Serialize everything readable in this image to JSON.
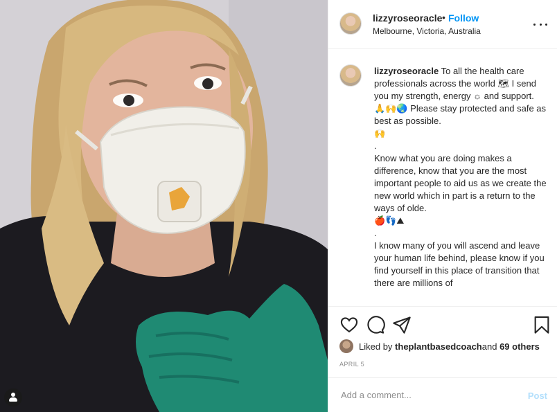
{
  "post": {
    "username": "lizzyroseoracle",
    "dot": "•",
    "follow_label": "Follow",
    "location": "Melbourne, Victoria, Australia",
    "more_icon": "more-horizontal-icon"
  },
  "caption": {
    "username": "lizzyroseoracle",
    "lines": [
      " To all the health care professionals across the world 🗺 I send you my strength, energy ☼ and support.",
      "🙏🙌🌏 Please stay protected and safe as best as possible.",
      "🙌",
      ".",
      "Know what you are doing makes a difference, know that you are the most important people to aid us as we create the new world which in part is a return to the ways of olde.",
      "🍎👣⛰",
      ".",
      "I know many of you will ascend and leave your human life behind, please know if you find yourself in this place of transition that there are millions of"
    ]
  },
  "actions": {
    "like_icon": "heart-icon",
    "comment_icon": "comment-icon",
    "share_icon": "paper-plane-icon",
    "save_icon": "bookmark-icon"
  },
  "likes": {
    "prefix": "Liked by ",
    "liker": "theplantbasedcoach",
    "middle": " and ",
    "others": "69 others"
  },
  "date": "APRIL 5",
  "comment": {
    "placeholder": "Add a comment...",
    "post_label": "Post"
  },
  "colors": {
    "accent": "#0095f6",
    "post_disabled": "#b2dffc",
    "text": "#262626",
    "muted": "#8e8e8e",
    "glove": "#1f8a73"
  }
}
